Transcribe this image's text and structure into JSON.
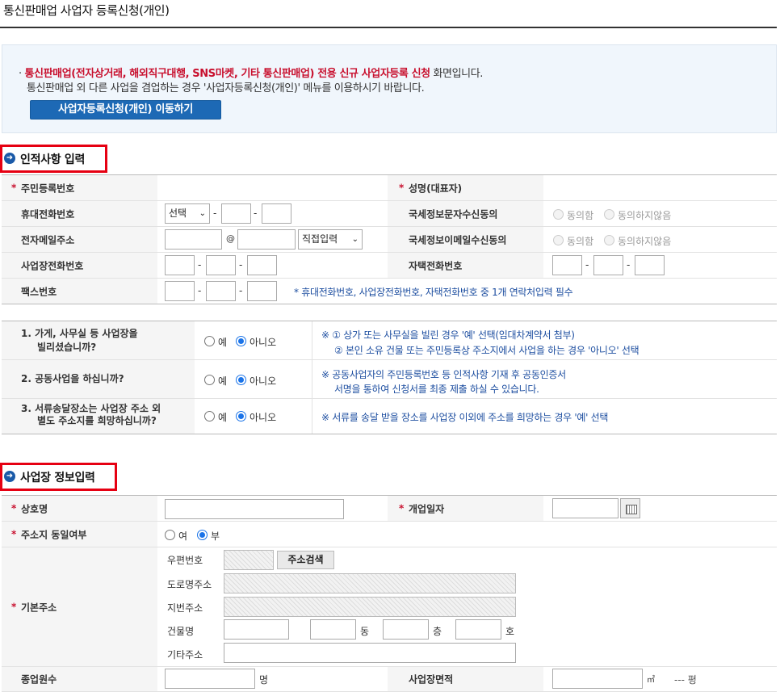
{
  "page_title": "통신판매업 사업자 등록신청(개인)",
  "notice": {
    "bullet": "·",
    "highlight": "통신판매업(전자상거래, 해외직구대행, SNS마켓, 기타 통신판매업) 전용 신규 사업자등록 신청",
    "line1_suffix": " 화면입니다.",
    "line2": "통신판매업 외 다른 사업을 겸업하는 경우 '사업자등록신청(개인)' 메뉴를 이용하시기 바랍니다.",
    "button": "사업자등록신청(개인) 이동하기"
  },
  "section1": {
    "title": "인적사항 입력",
    "labels": {
      "rrn": "주민등록번호",
      "name": "성명(대표자)",
      "mobile": "휴대전화번호",
      "tax_sms": "국세정보문자수신동의",
      "email": "전자메일주소",
      "tax_email": "국세정보이메일수신동의",
      "biz_phone": "사업장전화번호",
      "home_phone": "자택전화번호",
      "fax": "팩스번호"
    },
    "mobile_select": "선택",
    "email_at": "@",
    "email_domain_select": "직접입력",
    "agree": "동의함",
    "disagree": "동의하지않음",
    "dash": "-",
    "contact_note": "* 휴대전화번호, 사업장전화번호, 자택전화번호 중 1개 연락처입력 필수"
  },
  "questions": [
    {
      "q1": "1. 가게, 사무실 등 사업장을",
      "q2": "빌리셨습니까?",
      "yes": "예",
      "no": "아니오",
      "selected": "no",
      "note1": "※ ① 상가 또는 사무실을 빌린 경우 '예' 선택(임대차계약서 첨부)",
      "note2": "② 본인 소유 건물 또는 주민등록상 주소지에서 사업을 하는 경우 '아니오' 선택"
    },
    {
      "q1": "2. 공동사업을 하십니까?",
      "q2": "",
      "yes": "예",
      "no": "아니오",
      "selected": "no",
      "note1": "※ 공동사업자의 주민등록번호 등 인적사항 기재 후 공동인증서",
      "note2": "서명을 통하여 신청서를 최종 제출 하실 수 있습니다."
    },
    {
      "q1": "3. 서류송달장소는 사업장 주소 외",
      "q2": "별도 주소지를 희망하십니까?",
      "yes": "예",
      "no": "아니오",
      "selected": "no",
      "note1": "※ 서류를 송달 받을 장소를 사업장 이외에 주소를 희망하는 경우 '예' 선택",
      "note2": ""
    }
  ],
  "section2": {
    "title": "사업장 정보입력",
    "labels": {
      "trade_name": "상호명",
      "open_date": "개업일자",
      "same_address": "주소지 동일여부",
      "base_address": "기본주소",
      "employees": "종업원수",
      "area": "사업장면적"
    },
    "same_yes": "여",
    "same_no": "부",
    "same_selected": "no",
    "addr": {
      "zip": "우편번호",
      "search_btn": "주소검색",
      "road": "도로명주소",
      "lot": "지번주소",
      "building": "건물명",
      "dong": "동",
      "floor": "층",
      "ho": "호",
      "etc": "기타주소"
    },
    "employees_unit": "명",
    "area_unit": "㎡",
    "pyeong": "--- 평"
  }
}
